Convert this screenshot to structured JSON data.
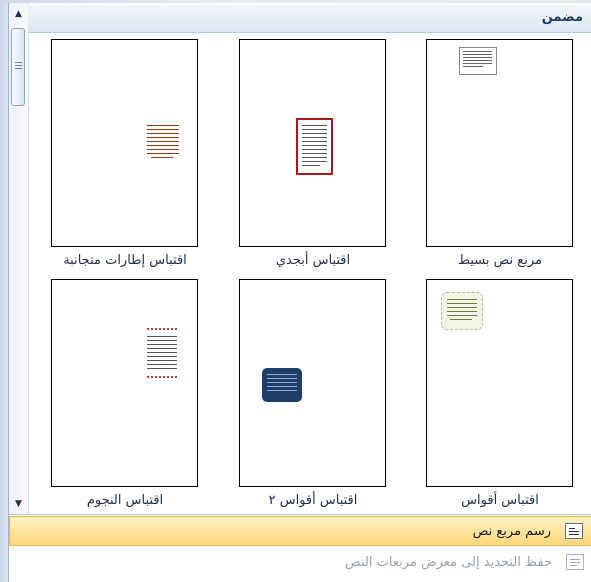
{
  "gallery": {
    "section_header": "مضمن",
    "items": [
      {
        "label": "مربع نص بسيط",
        "style": "simple"
      },
      {
        "label": "اقتباس أبجدي",
        "style": "alphabet"
      },
      {
        "label": "اقتباس إطارات متجانبة",
        "style": "tiles"
      },
      {
        "label": "اقتباس أقواس",
        "style": "braces"
      },
      {
        "label": "اقتباس أقواس ٢",
        "style": "braces2"
      },
      {
        "label": "اقتباس النجوم",
        "style": "stars"
      }
    ]
  },
  "menu": {
    "draw_textbox": "رسم مربع نص",
    "save_selection": "حفظ التحديد إلى معرض مربعات النص"
  },
  "colors": {
    "header_text": "#1b3a66",
    "hover_bg": "#ffd77a",
    "alphabet_border": "#a31a1a",
    "tiles_text": "#8a3b12",
    "braces2_fill": "#1f3f6b",
    "stars_color": "#c0392b"
  },
  "icons": [
    "scroll-up-icon",
    "scroll-down-icon",
    "textbox-draw-icon",
    "textbox-save-icon"
  ]
}
